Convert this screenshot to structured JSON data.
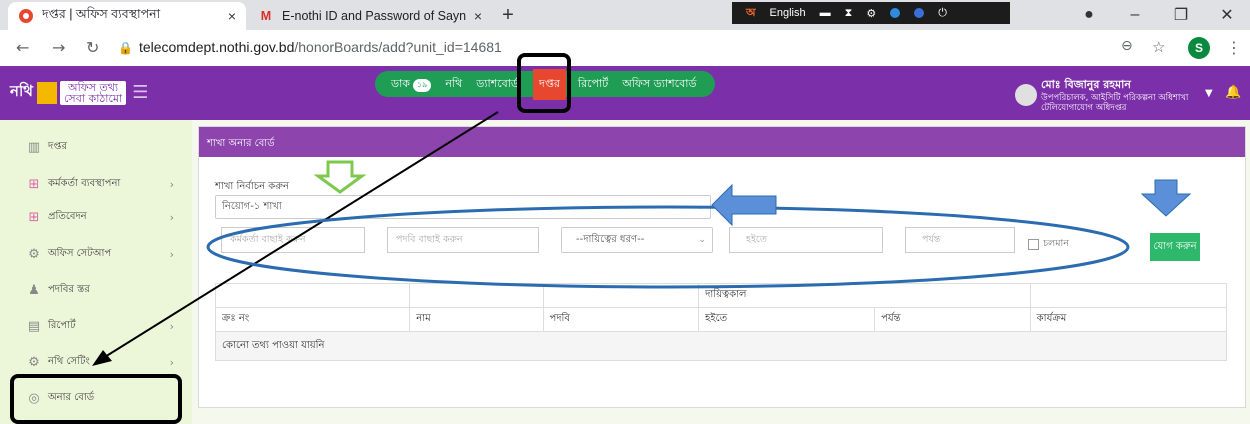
{
  "browser": {
    "tabs": [
      {
        "label": "দপ্তর | অফিস ব্যবস্থাপনা",
        "close": "×"
      },
      {
        "label": "E-nothi ID and Password of Sayn",
        "close": "×"
      }
    ],
    "new_tab": "+",
    "lang": "English",
    "url_host": "telecomdept.nothi.gov.bd",
    "url_path": "/honorBoards/add?unit_id=14681",
    "profile_initial": "S",
    "window_controls": [
      "–",
      "❐",
      "✕"
    ]
  },
  "app": {
    "logo_n": "নথি",
    "logo_line1": "অফিস তথ্য",
    "logo_line2": "সেবা কাঠামো",
    "menu": [
      {
        "label": "ডাক",
        "badge": "১৯"
      },
      {
        "label": "নথি"
      },
      {
        "label": "ড্যাশবোর্ড"
      },
      {
        "label": "দপ্তর",
        "active": true
      },
      {
        "label": "রিপোর্ট"
      },
      {
        "label": "অফিস ড্যাশবোর্ড"
      }
    ],
    "user_name": "মোঃ বিজানুর রহমান",
    "user_role": "উপপরিচালক, আইসিটি পরিকল্পনা অধিশাখা টেলিযোগাযোগ অধিদপ্তর"
  },
  "sidebar": {
    "items": [
      {
        "label": "দপ্তর",
        "icon": "building-icon",
        "arrow": false
      },
      {
        "label": "কর্মকর্তা ব্যবস্থাপনা",
        "icon": "org-icon",
        "arrow": true
      },
      {
        "label": "প্রতিবেদন",
        "icon": "org-icon",
        "arrow": true
      },
      {
        "label": "অফিস সেটআপ",
        "icon": "gear-icon",
        "arrow": true
      },
      {
        "label": "পদবির স্তর",
        "icon": "user-icon",
        "arrow": false
      },
      {
        "label": "রিপোর্ট",
        "icon": "report-icon",
        "arrow": true
      },
      {
        "label": "নথি সেটিং",
        "icon": "settings-icon",
        "arrow": true
      },
      {
        "label": "অনার বোর্ড",
        "icon": "honor-icon",
        "arrow": false
      }
    ]
  },
  "panel": {
    "title": "শাখা অনার বোর্ড",
    "branch_label": "শাখা নির্বাচন করুন",
    "branch_value": "নিয়োগ-১ শাখা",
    "officer_placeholder": "কর্মকর্তা বাছাই করুন",
    "designation_placeholder": "পদবি বাছাই করুন",
    "responsibility_type": "--দায়িত্বের ধরণ--",
    "from_placeholder": "হইতে",
    "to_placeholder": "পর্যন্ত",
    "ongoing_label": "চলমান",
    "add_button": "যোগ করুন"
  },
  "table": {
    "group_header": "দায়িত্বকাল",
    "columns": [
      "ক্রঃ নং",
      "নাম",
      "পদবি",
      "হইতে",
      "পর্যন্ত",
      "কার্যক্রম"
    ],
    "empty_message": "কোনো তথ্য পাওয়া যায়নি"
  },
  "colors": {
    "purple": "#7b2fa8",
    "panel_header": "#8e44ad",
    "green_menu": "#1f9d55",
    "active_menu": "#e8472f",
    "add_button": "#2eb86b",
    "sidebar_bg": "#ecf7d9",
    "annotation_blue": "#2b6cb0",
    "annotation_green": "#7cc94d"
  }
}
